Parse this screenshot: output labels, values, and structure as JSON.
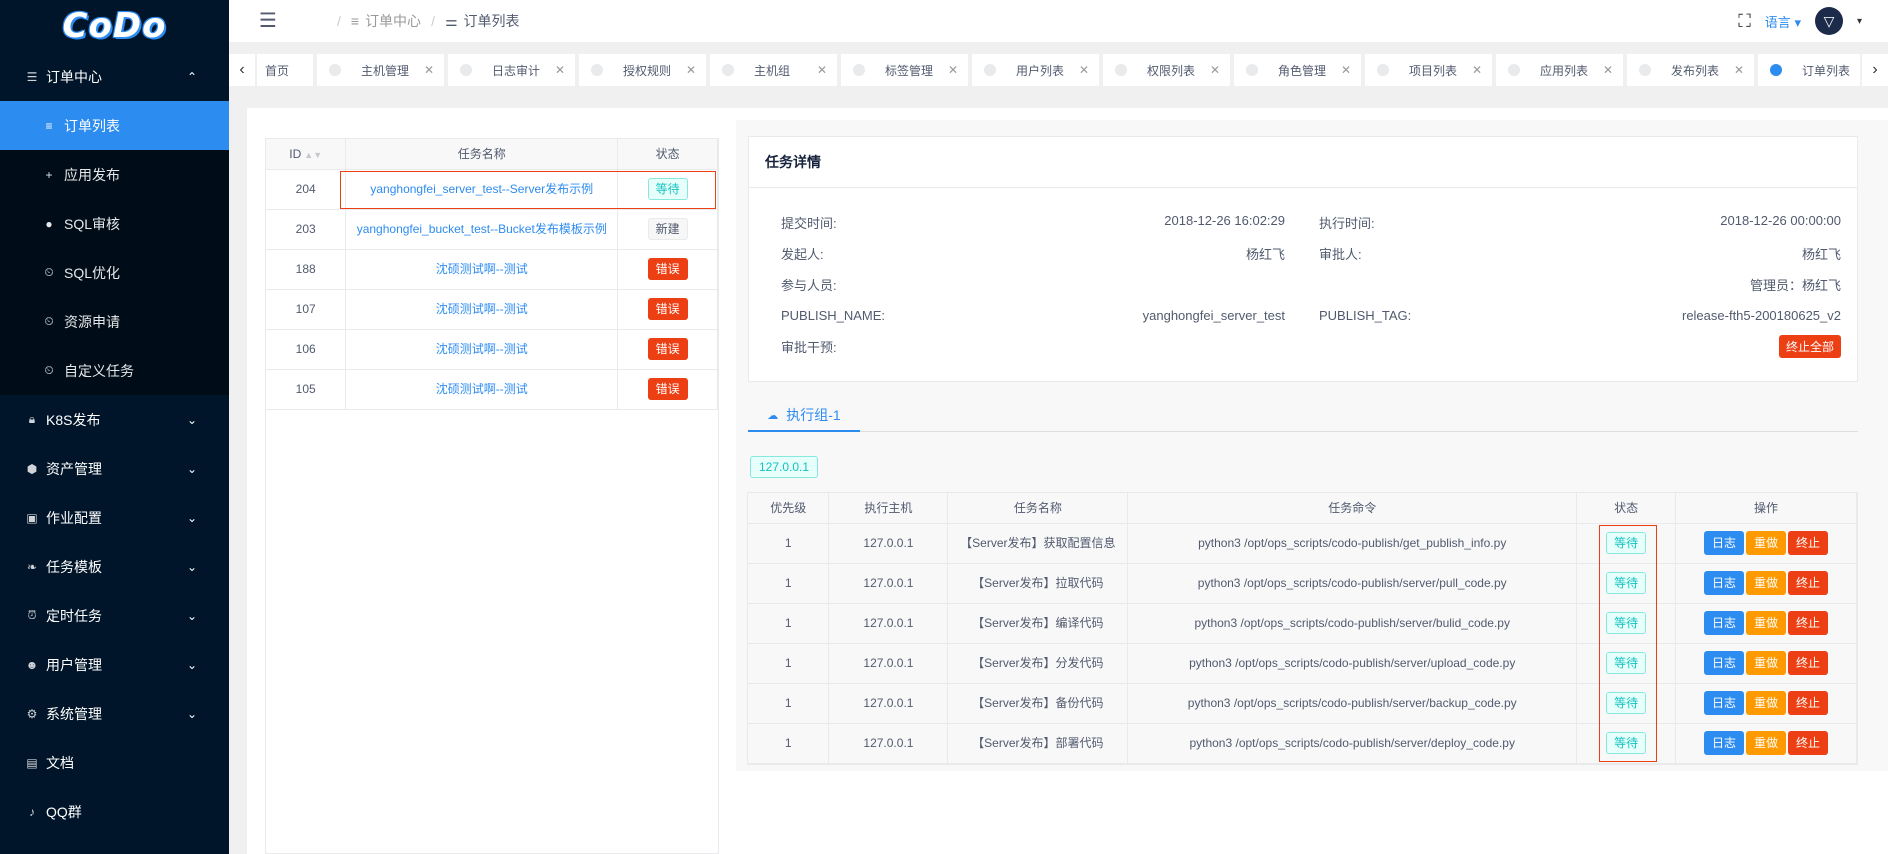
{
  "app": {
    "logo": "CoDo"
  },
  "sidebar": {
    "order_center": {
      "label": "订单中心",
      "items": [
        {
          "label": "订单列表",
          "icon": "list-icon"
        },
        {
          "label": "应用发布",
          "icon": "plus-icon"
        },
        {
          "label": "SQL审核",
          "icon": "circle-icon"
        },
        {
          "label": "SQL优化",
          "icon": "clock-icon"
        },
        {
          "label": "资源申请",
          "icon": "clock-icon"
        },
        {
          "label": "自定义任务",
          "icon": "clock-icon"
        }
      ]
    },
    "groups": [
      {
        "label": "K8S发布",
        "icon": "lock-icon"
      },
      {
        "label": "资产管理",
        "icon": "cube-icon"
      },
      {
        "label": "作业配置",
        "icon": "briefcase-icon"
      },
      {
        "label": "任务模板",
        "icon": "leaf-icon"
      },
      {
        "label": "定时任务",
        "icon": "alarm-icon"
      },
      {
        "label": "用户管理",
        "icon": "users-icon"
      },
      {
        "label": "系统管理",
        "icon": "gear-icon"
      }
    ],
    "links": [
      {
        "label": "文档",
        "icon": "book-icon"
      },
      {
        "label": "QQ群",
        "icon": "bell-icon"
      }
    ]
  },
  "header": {
    "breadcrumb": [
      "订单中心",
      "订单列表"
    ],
    "lang": "语言"
  },
  "tabs": [
    {
      "label": "首页"
    },
    {
      "label": "主机管理"
    },
    {
      "label": "日志审计"
    },
    {
      "label": "授权规则"
    },
    {
      "label": "主机组"
    },
    {
      "label": "标签管理"
    },
    {
      "label": "用户列表"
    },
    {
      "label": "权限列表"
    },
    {
      "label": "角色管理"
    },
    {
      "label": "项目列表"
    },
    {
      "label": "应用列表"
    },
    {
      "label": "发布列表"
    },
    {
      "label": "订单列表"
    }
  ],
  "order_list": {
    "columns": [
      "ID",
      "任务名称",
      "状态"
    ],
    "rows": [
      {
        "id": "204",
        "name": "yanghongfei_server_test--Server发布示例",
        "status": "等待"
      },
      {
        "id": "203",
        "name": "yanghongfei_bucket_test--Bucket发布模板示例",
        "status": "新建"
      },
      {
        "id": "188",
        "name": "沈硕测试啊--测试",
        "status": "错误"
      },
      {
        "id": "107",
        "name": "沈硕测试啊--测试",
        "status": "错误"
      },
      {
        "id": "106",
        "name": "沈硕测试啊--测试",
        "status": "错误"
      },
      {
        "id": "105",
        "name": "沈硕测试啊--测试",
        "status": "错误"
      }
    ]
  },
  "detail": {
    "title": "任务详情",
    "submit_time_label": "提交时间:",
    "submit_time": "2018-12-26 16:02:29",
    "exec_time_label": "执行时间:",
    "exec_time": "2018-12-26 00:00:00",
    "initiator_label": "发起人:",
    "initiator": "杨红飞",
    "approver_label": "审批人:",
    "approver": "杨红飞",
    "participants_label": "参与人员:",
    "participants": "",
    "admin_label": "",
    "admin": "管理员：杨红飞",
    "publish_name_label": "PUBLISH_NAME:",
    "publish_name": "yanghongfei_server_test",
    "publish_tag_label": "PUBLISH_TAG:",
    "publish_tag": "release-fth5-200180625_v2",
    "intervene_label": "审批干预:",
    "stop_all": "终止全部"
  },
  "exec_group": {
    "tab": "执行组-1",
    "host": "127.0.0.1"
  },
  "task_table": {
    "columns": [
      "优先级",
      "执行主机",
      "任务名称",
      "任务命令",
      "状态",
      "操作"
    ],
    "actions": {
      "log": "日志",
      "redo": "重做",
      "stop": "终止"
    },
    "rows": [
      {
        "priority": "1",
        "host": "127.0.0.1",
        "name": "【Server发布】获取配置信息",
        "cmd": "python3 /opt/ops_scripts/codo-publish/get_publish_info.py",
        "status": "等待"
      },
      {
        "priority": "1",
        "host": "127.0.0.1",
        "name": "【Server发布】拉取代码",
        "cmd": "python3 /opt/ops_scripts/codo-publish/server/pull_code.py",
        "status": "等待"
      },
      {
        "priority": "1",
        "host": "127.0.0.1",
        "name": "【Server发布】编译代码",
        "cmd": "python3 /opt/ops_scripts/codo-publish/server/bulid_code.py",
        "status": "等待"
      },
      {
        "priority": "1",
        "host": "127.0.0.1",
        "name": "【Server发布】分发代码",
        "cmd": "python3 /opt/ops_scripts/codo-publish/server/upload_code.py",
        "status": "等待"
      },
      {
        "priority": "1",
        "host": "127.0.0.1",
        "name": "【Server发布】备份代码",
        "cmd": "python3 /opt/ops_scripts/codo-publish/server/backup_code.py",
        "status": "等待"
      },
      {
        "priority": "1",
        "host": "127.0.0.1",
        "name": "【Server发布】部署代码",
        "cmd": "python3 /opt/ops_scripts/codo-publish/server/deploy_code.py",
        "status": "等待"
      }
    ]
  }
}
